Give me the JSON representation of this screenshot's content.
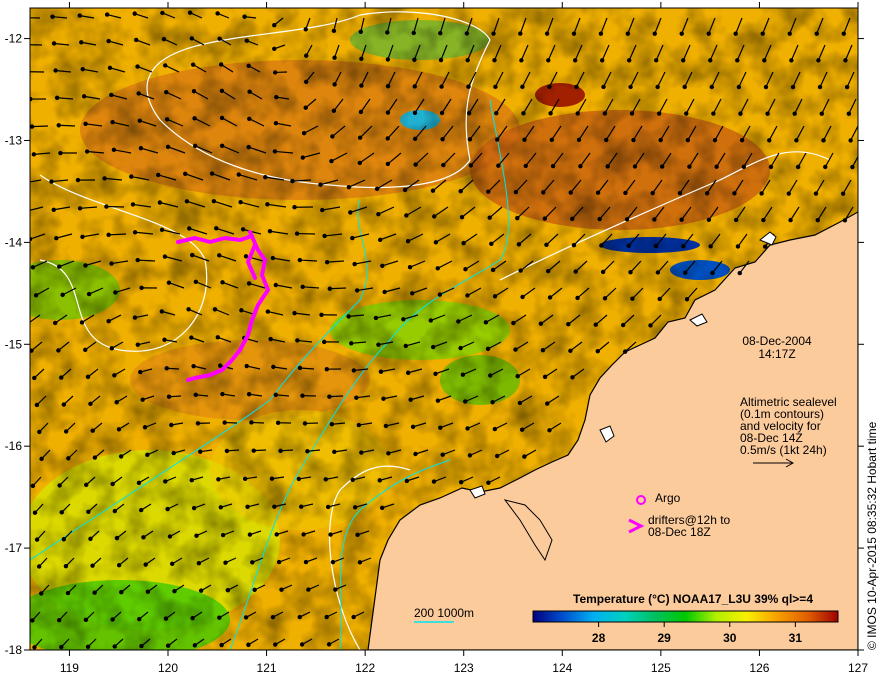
{
  "map": {
    "lon_range": [
      118.6,
      127.0
    ],
    "lat_range": [
      -18.0,
      -11.7
    ],
    "lon_ticks": [
      "119",
      "120",
      "121",
      "122",
      "123",
      "124",
      "125",
      "126",
      "127"
    ],
    "lat_ticks": [
      "-12",
      "-13",
      "-14",
      "-15",
      "-16",
      "-17",
      "-18"
    ],
    "colors": {
      "land": "#fccb9c",
      "coastline": "#000000",
      "sealevel_contour": "#ffffff",
      "bathymetry_contour": "#00e5ee",
      "drifter": "#ff00ff",
      "argo": "#ff00ff"
    }
  },
  "annotations": {
    "date": "08-Dec-2004",
    "time": "14:17Z",
    "altimetry_lines": [
      "Altimetric sealevel",
      "(0.1m contours)",
      "and velocity for",
      "08-Dec 14Z",
      "0.5m/s (1kt 24h)"
    ],
    "argo_label": "Argo",
    "drifters_lines": [
      "drifters@12h to",
      "08-Dec 18Z"
    ],
    "bathymetry_label": "200  1000m",
    "credit": "© IMOS 10-Apr-2015 08:35:32 Hobart time"
  },
  "colorbar": {
    "title": "Temperature (°C) NOAA17_L3U 39% ql>=4",
    "range": [
      27.0,
      31.65
    ],
    "ticks": [
      "28",
      "29",
      "30",
      "31"
    ],
    "colormap": [
      "#00007f",
      "#0050d0",
      "#00b0f0",
      "#00d0c0",
      "#00c060",
      "#00c800",
      "#b0f000",
      "#f8f000",
      "#f8a000",
      "#e06000",
      "#a00000"
    ]
  }
}
